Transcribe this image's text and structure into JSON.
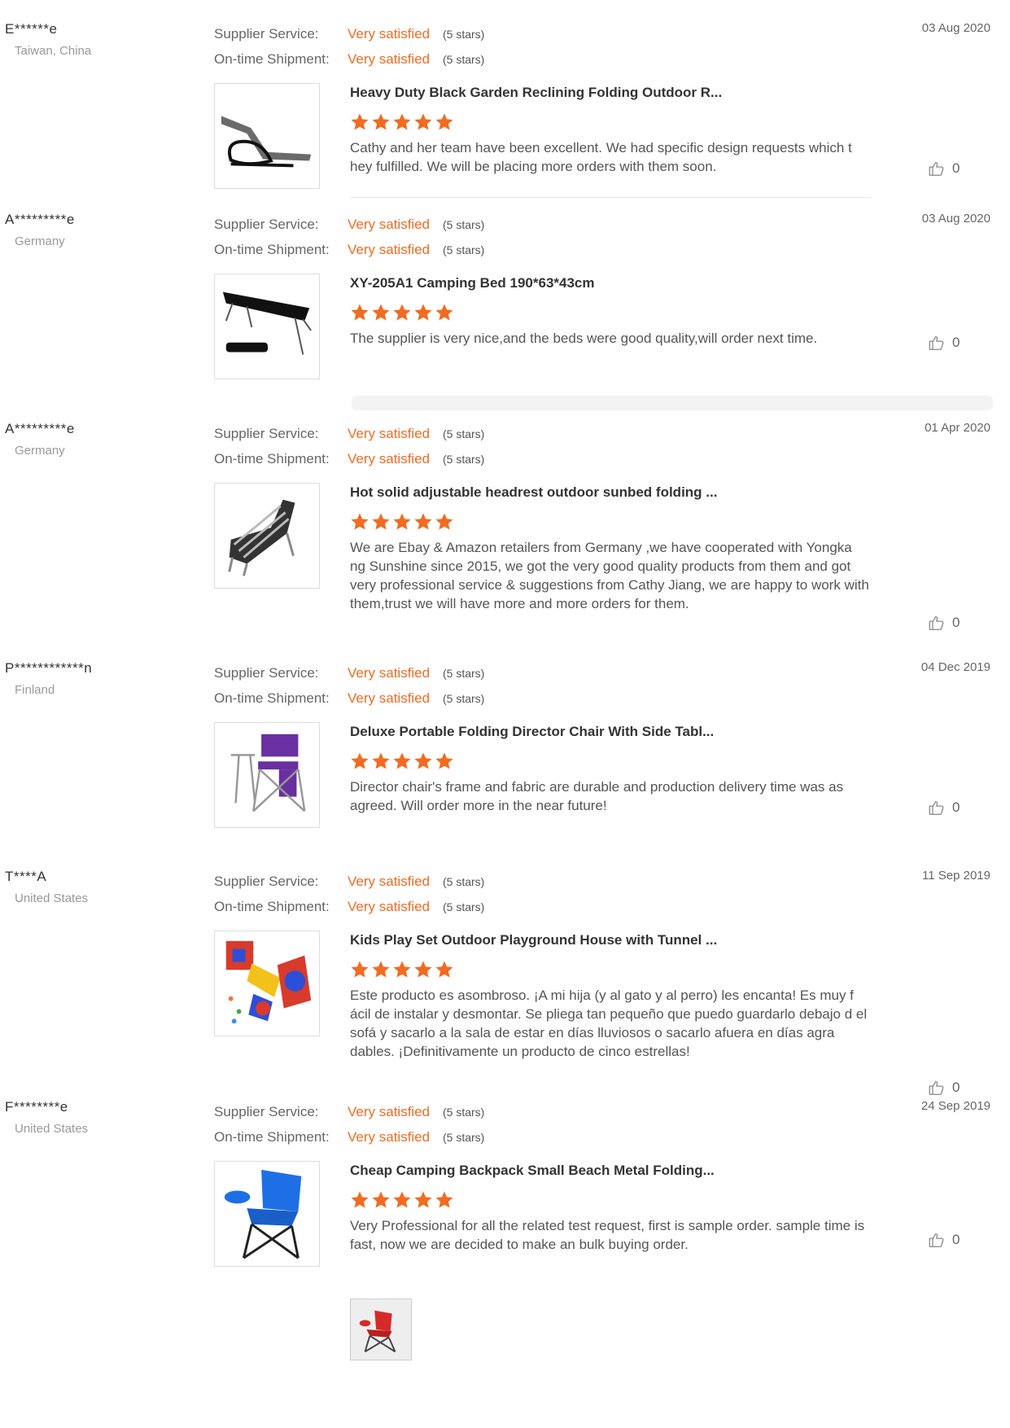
{
  "reviews": [
    {
      "buyer": "E******e",
      "location": "Taiwan, China",
      "date": "03 Aug 2020",
      "supplier_label": "Supplier Service:",
      "supplier_value": "Very satisfied",
      "supplier_note": "(5 stars)",
      "shipment_label": "On-time Shipment:",
      "shipment_value": "Very satisfied",
      "shipment_note": "(5 stars)",
      "product_title": "Heavy Duty Black Garden Reclining Folding Outdoor R...",
      "rating": 5,
      "comment": "Cathy and her team have been excellent. We had specific design requests which t hey fulfilled. We will be placing more orders with them soon.",
      "likes": "0",
      "image_icon": "lounge-chair-icon"
    },
    {
      "buyer": "A*********e",
      "location": "Germany",
      "date": "03 Aug 2020",
      "supplier_label": "Supplier Service:",
      "supplier_value": "Very satisfied",
      "supplier_note": "(5 stars)",
      "shipment_label": "On-time Shipment:",
      "shipment_value": "Very satisfied",
      "shipment_note": "(5 stars)",
      "product_title": "XY-205A1 Camping Bed 190*63*43cm",
      "rating": 5,
      "comment": "The supplier is very nice,and the beds were good quality,will order next time.",
      "likes": "0",
      "image_icon": "camping-bed-icon"
    },
    {
      "buyer": "A*********e",
      "location": "Germany",
      "date": "01 Apr 2020",
      "supplier_label": "Supplier Service:",
      "supplier_value": "Very satisfied",
      "supplier_note": "(5 stars)",
      "shipment_label": "On-time Shipment:",
      "shipment_value": "Very satisfied",
      "shipment_note": "(5 stars)",
      "product_title": "Hot solid adjustable headrest outdoor sunbed folding ...",
      "rating": 5,
      "comment": "We are Ebay & Amazon retailers from Germany ,we have cooperated with Yongka ng Sunshine since 2015, we got the very good quality products from them and got very professional service & suggestions from Cathy Jiang, we are happy to work with them,trust we will have more and more orders for them.",
      "likes": "0",
      "image_icon": "sunbed-icon"
    },
    {
      "buyer": "P************n",
      "location": "Finland",
      "date": "04 Dec 2019",
      "supplier_label": "Supplier Service:",
      "supplier_value": "Very satisfied",
      "supplier_note": "(5 stars)",
      "shipment_label": "On-time Shipment:",
      "shipment_value": "Very satisfied",
      "shipment_note": "(5 stars)",
      "product_title": "Deluxe Portable Folding Director Chair With Side Tabl...",
      "rating": 5,
      "comment": "Director chair's frame and fabric are durable and production delivery time was as agreed. Will order more in the near future!",
      "likes": "0",
      "image_icon": "director-chair-icon"
    },
    {
      "buyer": "T****A",
      "location": "United States",
      "date": "11 Sep 2019",
      "supplier_label": "Supplier Service:",
      "supplier_value": "Very satisfied",
      "supplier_note": "(5 stars)",
      "shipment_label": "On-time Shipment:",
      "shipment_value": "Very satisfied",
      "shipment_note": "(5 stars)",
      "product_title": "Kids Play Set Outdoor Playground House with Tunnel ...",
      "rating": 5,
      "comment": "Este producto es asombroso. ¡A mi hija (y al gato y al perro) les encanta! Es muy f ácil de instalar y desmontar. Se pliega tan pequeño que puedo guardarlo debajo d el sofá y sacarlo a la sala de estar en días lluviosos o sacarlo afuera en días agra dables. ¡Definitivamente un producto de cinco estrellas!",
      "likes": "0",
      "image_icon": "play-tent-icon"
    },
    {
      "buyer": "F********e",
      "location": "United States",
      "date": "24 Sep 2019",
      "supplier_label": "Supplier Service:",
      "supplier_value": "Very satisfied",
      "supplier_note": "(5 stars)",
      "shipment_label": "On-time Shipment:",
      "shipment_value": "Very satisfied",
      "shipment_note": "(5 stars)",
      "product_title": "Cheap Camping Backpack Small Beach Metal Folding...",
      "rating": 5,
      "comment": "Very Professional for all the related test request, first is sample order. sample time is fast, now we are decided to make an bulk buying order.",
      "likes": "0",
      "image_icon": "camping-chair-icon",
      "attachment_icon": "red-chair-photo-icon"
    }
  ],
  "colors": {
    "accent": "#f26b21",
    "label": "#666666",
    "muted": "#999999"
  }
}
